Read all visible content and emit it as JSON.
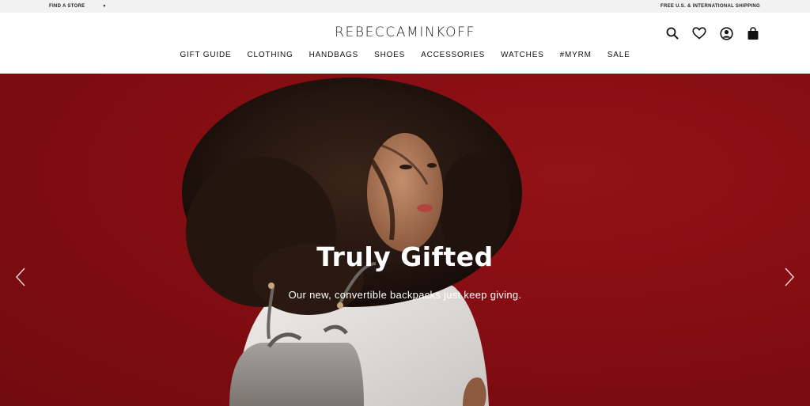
{
  "topbar": {
    "find_store": "FIND A STORE",
    "find_caret": "▼",
    "shipping": "FREE U.S. & INTERNATIONAL SHIPPING"
  },
  "header": {
    "logo_part1": "REBECCA",
    "logo_part2": "MINKOFF",
    "icons": [
      "search-icon",
      "heart-icon",
      "account-icon",
      "shopping-bag-icon"
    ]
  },
  "nav": {
    "items": [
      "GIFT GUIDE",
      "CLOTHING",
      "HANDBAGS",
      "SHOES",
      "ACCESSORIES",
      "WATCHES",
      "#MYRM",
      "SALE"
    ]
  },
  "hero": {
    "title": "Truly Gifted",
    "subtitle": "Our new, convertible backpacks just keep giving.",
    "background_color": "#8a0f14",
    "prev_icon": "chevron-left-icon",
    "next_icon": "chevron-right-icon"
  }
}
